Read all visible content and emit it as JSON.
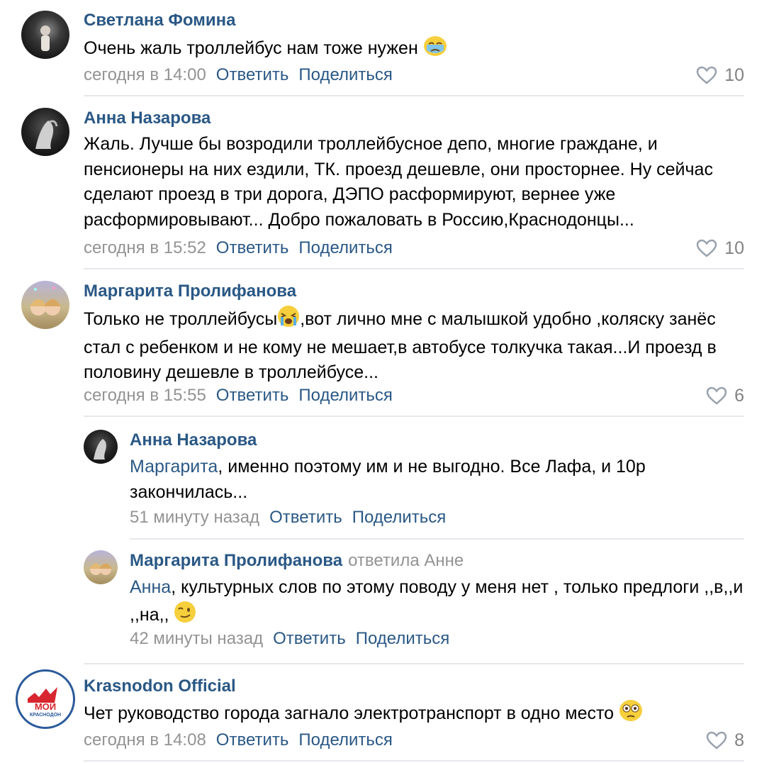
{
  "comments": [
    {
      "author": "Светлана Фомина",
      "text": "Очень жаль троллейбус нам тоже нужен",
      "time": "сегодня в 14:00",
      "reply": "Ответить",
      "share": "Поделиться",
      "likes": "10"
    },
    {
      "author": "Анна Назарова",
      "text": "Жаль. Лучше бы возродили троллейбусное депо, многие граждане, и пенсионеры на них ездили, ТК. проезд дешевле, они просторнее. Ну сейчас сделают проезд в три дорога, ДЭПО расформируют, вернее уже расформировывают... Добро пожаловать в Россию,Краснодонцы...",
      "time": "сегодня в 15:52",
      "reply": "Ответить",
      "share": "Поделиться",
      "likes": "10"
    },
    {
      "author": "Маргарита Пролифанова",
      "text_a": "Только не троллейбусы",
      "text_b": ",вот лично мне с малышкой удобно ,коляску занёс стал с ребенком и не кому не мешает,в автобусе толкучка такая...И проезд в половину дешевле в троллейбусе...",
      "time": "сегодня в 15:55",
      "reply": "Ответить",
      "share": "Поделиться",
      "likes": "6"
    },
    {
      "author": "Krasnodon Official",
      "text": "Чет руководство города загнало электротранспорт в одно место",
      "time": "сегодня в 14:08",
      "reply": "Ответить",
      "share": "Поделиться",
      "likes": "8",
      "logo_top": "МОЙ",
      "logo_bottom": "КРАСНОДОН"
    }
  ],
  "replies": [
    {
      "author": "Анна Назарова",
      "mention": "Маргарита",
      "text": ", именно поэтому им и не выгодно. Все Лафа, и 10р закончилась...",
      "time": "51 минуту назад",
      "reply": "Ответить",
      "share": "Поделиться"
    },
    {
      "author": "Маргарита Пролифанова",
      "reply_note": "ответила Анне",
      "mention": "Анна",
      "text": ", культурных слов по этому поводу у меня нет , только предлоги ,,в,,и ,,на,,",
      "time": "42 минуты назад",
      "reply": "Ответить",
      "share": "Поделиться"
    }
  ],
  "colors": {
    "link": "#2a5885",
    "muted": "#939393",
    "separator": "#e7e8ec",
    "logo_red": "#d7262f",
    "logo_blue": "#2a5a9a"
  },
  "icons": [
    "heart-icon",
    "sad-emoji-icon",
    "crying-emoji-icon",
    "wink-emoji-icon",
    "flushed-emoji-icon"
  ]
}
